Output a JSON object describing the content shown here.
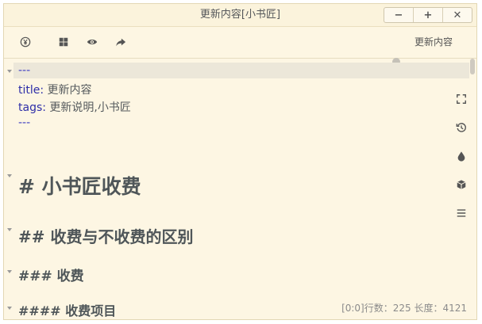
{
  "window": {
    "title": "更新内容[小书匠]",
    "controls": {
      "minimize": "−",
      "maximize": "+",
      "close": "✕"
    }
  },
  "toolbar": {
    "doc_title": "更新内容",
    "icons": [
      "yen-circle-icon",
      "grid-icon",
      "eye-icon",
      "share-forward-icon"
    ]
  },
  "editor": {
    "front_matter": {
      "open_delim": "---",
      "title_key": "title",
      "title_sep": ": ",
      "title_value": "更新内容",
      "tags_key": "tags",
      "tags_sep": ": ",
      "tags_value": "更新说明,小书匠",
      "close_delim": "---"
    },
    "headings": {
      "h1": "# 小书匠收费",
      "h2": "## 收费与不收费的区别",
      "h3": "### 收费",
      "h4": "#### 收费项目"
    }
  },
  "side_tools": [
    "fullscreen-icon",
    "history-icon",
    "ink-drop-icon",
    "package-box-icon",
    "menu-icon"
  ],
  "status": {
    "text": "[0:0]行数：225 长度：4121"
  },
  "colors": {
    "background": "#fdf6e3",
    "front_matter_key": "#2e2ea8",
    "front_matter_delim": "#3d3dc2",
    "heading": "#4f5659"
  }
}
